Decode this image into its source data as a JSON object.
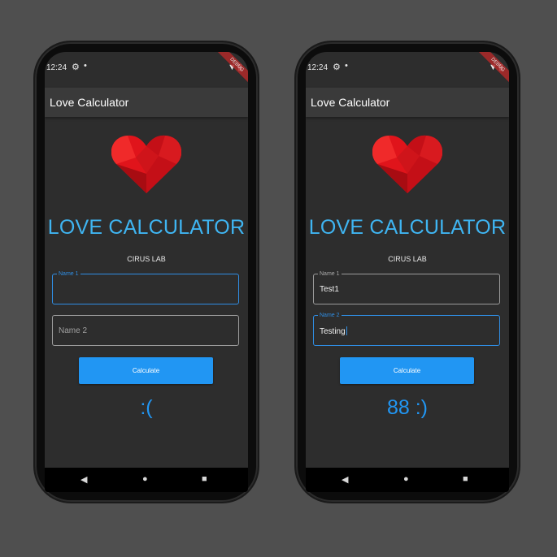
{
  "left_phone": {
    "status": {
      "time": "12:24",
      "banner": "DEBUG"
    },
    "appbar_title": "Love Calculator",
    "headline": "LOVE CALCULATOR",
    "subtitle": "CIRUS LAB",
    "name1": {
      "label": "Name 1",
      "value": ""
    },
    "name2": {
      "placeholder": "Name 2",
      "value": ""
    },
    "button_label": "Calculate",
    "result": ":("
  },
  "right_phone": {
    "status": {
      "time": "12:24",
      "banner": "DEBUG"
    },
    "appbar_title": "Love Calculator",
    "headline": "LOVE CALCULATOR",
    "subtitle": "CIRUS LAB",
    "name1": {
      "label": "Name 1",
      "value": "Test1"
    },
    "name2": {
      "label": "Name 2",
      "value": "Testing"
    },
    "button_label": "Calculate",
    "result": "88 :)"
  },
  "colors": {
    "accent": "#3fb5f2",
    "button": "#2196f3",
    "heart": "#e0141b",
    "background": "#4f4f4f",
    "screen": "#2d2d2d"
  },
  "icons": {
    "status_left": [
      "settings-icon",
      "notification-dot-icon"
    ],
    "status_right": [
      "wifi-icon",
      "battery-icon"
    ],
    "nav": [
      "back-icon",
      "home-icon",
      "recents-icon"
    ]
  }
}
